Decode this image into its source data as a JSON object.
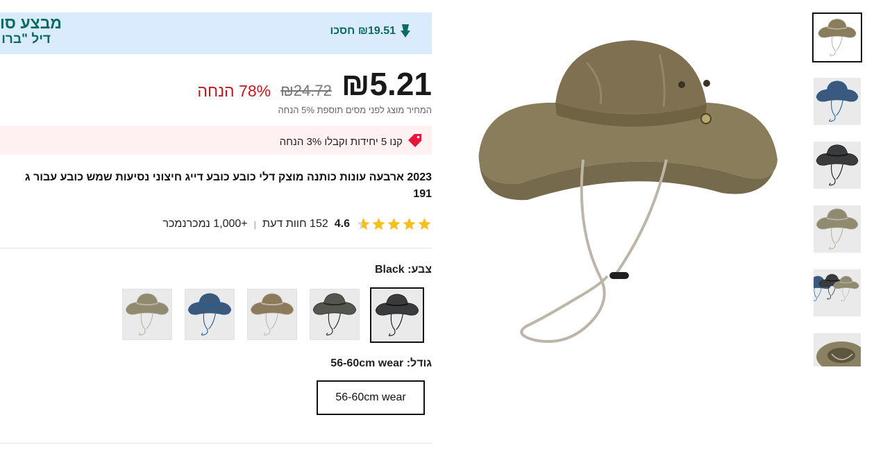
{
  "deal": {
    "title": "מבצע סו",
    "subtitle": "דיל \"ברו",
    "save_text": "₪19.51 חסכו"
  },
  "price": {
    "current": "₪5.21",
    "original": "₪24.72",
    "discount": "78% הנחה",
    "tax_note": "המחיר מוצג לפני מסים תוספת 5% הנחה"
  },
  "bulk_promo": "קנו 5 יחידות וקבלו 3% הנחה",
  "product": {
    "title_line1": "2023 ארבעה עונות כותנה מוצק דלי כובע כובע דייג חיצוני נסיעות שמש כובע עבור ג",
    "title_line2": "191"
  },
  "rating": {
    "value": "4.6",
    "stars": 4.6,
    "reviews": "152 חוות דעת",
    "sold": "+1,000 נמכרנמכר"
  },
  "color": {
    "label": "צבע: Black",
    "options": [
      "Black",
      "Dark Gray",
      "Khaki",
      "Navy Blue",
      "Beige"
    ],
    "selected": "Black"
  },
  "size": {
    "label": "גודל: 56-60cm wear",
    "option": "56-60cm wear"
  },
  "colors": {
    "brand_green": "#0b6b62",
    "banner_bg": "#d9ebfd",
    "discount_red": "#c4161c",
    "star_yellow": "#f6c01c"
  },
  "icons": {
    "save": "down-arrow-icon",
    "bulk": "price-tag-icon",
    "rating": "star-icon"
  }
}
